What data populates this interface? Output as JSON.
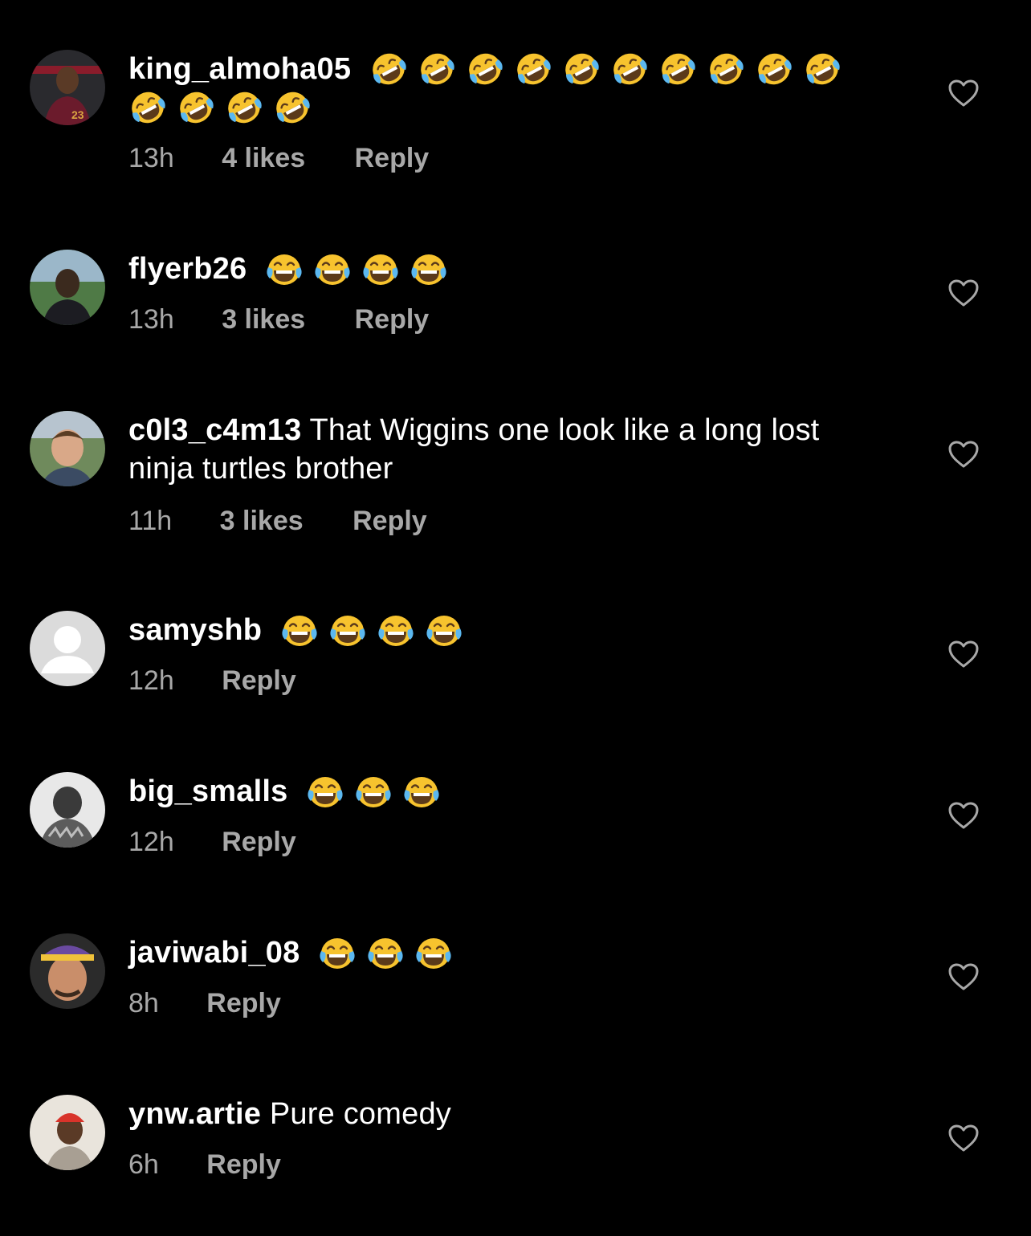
{
  "comments": [
    {
      "username": "king_almoha05",
      "text": "",
      "emoji": [
        "rofl",
        "rofl",
        "rofl",
        "rofl",
        "rofl",
        "rofl",
        "rofl",
        "rofl",
        "rofl",
        "rofl",
        "rofl",
        "rofl",
        "rofl",
        "rofl"
      ],
      "time": "13h",
      "likes": "4 likes",
      "reply": "Reply",
      "avatar": "avatar-photo"
    },
    {
      "username": "flyerb26",
      "text": "",
      "emoji": [
        "joy",
        "joy",
        "joy",
        "joy"
      ],
      "time": "13h",
      "likes": "3 likes",
      "reply": "Reply",
      "avatar": "avatar-photo"
    },
    {
      "username": "c0l3_c4m13",
      "text": "That Wiggins one look like a long lost ninja turtles brother",
      "emoji": [],
      "time": "11h",
      "likes": "3 likes",
      "reply": "Reply",
      "avatar": "avatar-photo"
    },
    {
      "username": "samyshb",
      "text": "",
      "emoji": [
        "joy",
        "joy",
        "joy",
        "joy"
      ],
      "time": "12h",
      "likes": "",
      "reply": "Reply",
      "avatar": "default-avatar"
    },
    {
      "username": "big_smalls",
      "text": "",
      "emoji": [
        "joy",
        "joy",
        "joy"
      ],
      "time": "12h",
      "likes": "",
      "reply": "Reply",
      "avatar": "avatar-photo"
    },
    {
      "username": "javiwabi_08",
      "text": "",
      "emoji": [
        "joy",
        "joy",
        "joy"
      ],
      "time": "8h",
      "likes": "",
      "reply": "Reply",
      "avatar": "avatar-photo"
    },
    {
      "username": "ynw.artie",
      "text": "Pure comedy",
      "emoji": [],
      "time": "6h",
      "likes": "",
      "reply": "Reply",
      "avatar": "avatar-photo"
    }
  ],
  "colors": {
    "background": "#000000",
    "primary_text": "#ffffff",
    "secondary_text": "#a8a8a8",
    "emoji_face": "#f7c32e",
    "emoji_tear": "#5bb8f0"
  },
  "icons": {
    "like": "heart-outline-icon",
    "rofl": "rolling-on-floor-laughing-emoji",
    "joy": "tears-of-joy-emoji"
  }
}
